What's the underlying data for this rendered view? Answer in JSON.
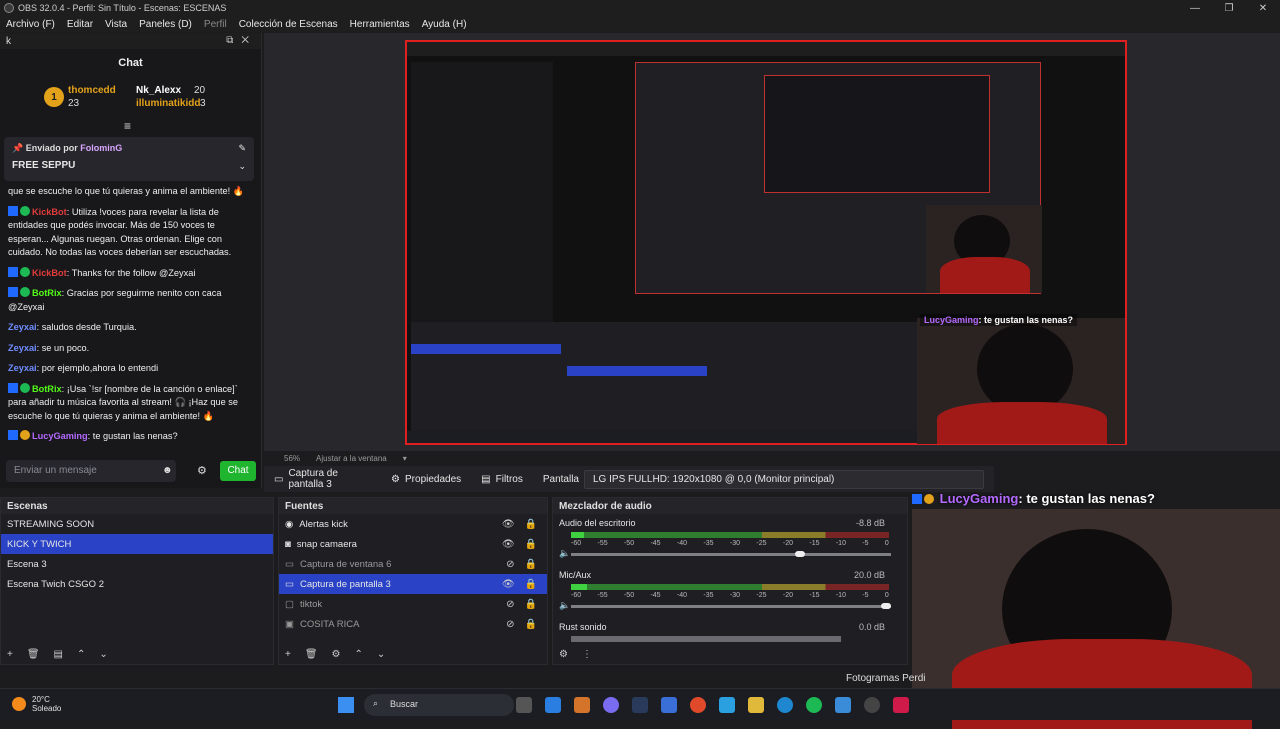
{
  "window": {
    "title": "OBS 32.0.4 - Perfil: Sin Título - Escenas: ESCENAS"
  },
  "menu": [
    {
      "label": "Archivo (F)"
    },
    {
      "label": "Editar"
    },
    {
      "label": "Vista"
    },
    {
      "label": "Paneles (D)"
    },
    {
      "label": "Perfil"
    },
    {
      "label": "Colección de Escenas"
    },
    {
      "label": "Herramientas"
    },
    {
      "label": "Ayuda (H)"
    }
  ],
  "chat": {
    "dock_title": "k",
    "title": "Chat",
    "leaderboard": {
      "rank": "1",
      "first": {
        "name": "thomcedd",
        "value": "23"
      },
      "second": {
        "name": "Nk_Alexx",
        "value": "20"
      },
      "third": {
        "name": "illuminatikidd",
        "value": "3"
      }
    },
    "pinned": {
      "prefix": "Enviado por",
      "user": "FolominG",
      "text": "FREE SEPPU"
    },
    "messages": [
      {
        "user": "",
        "text": "que se escuche lo que tú quieras y anima el ambiente! 🔥"
      },
      {
        "user": "KickBot",
        "text": ": Utiliza !voces para revelar la lista de entidades que podés invocar. Más de 150 voces te esperan... Algunas ruegan. Otras ordenan. Elige con cuidado. No todas las voces deberían ser escuchadas."
      },
      {
        "user": "KickBot",
        "text": ": Thanks for the follow @Zeyxai"
      },
      {
        "user": "BotRix",
        "text": ": Gracias por seguirme nenito con caca @Zeyxai"
      },
      {
        "user": "Zeyxai",
        "text": ": saludos desde Turquia."
      },
      {
        "user": "Zeyxai",
        "text": ": se un poco."
      },
      {
        "user": "Zeyxai",
        "text": ": por ejemplo,ahora lo entendi"
      },
      {
        "user": "BotRix",
        "text": ": ¡Usa `!sr [nombre de la canción o enlace]` para añadir tu música favorita al stream! 🎧 ¡Haz que se escuche lo que tú quieras y anima el ambiente! 🔥"
      },
      {
        "user": "LucyGaming",
        "text": ": te gustan las nenas?"
      }
    ],
    "input_placeholder": "Enviar un mensaje",
    "send_label": "Chat"
  },
  "overlay_text": {
    "user": "LucyGaming",
    "text": ": te gustan las nenas?"
  },
  "preview_status": {
    "zoom": "56%",
    "fit": "Ajustar a la ventana"
  },
  "toolbar": {
    "source_name": "Captura de pantalla 3",
    "properties": "Propiedades",
    "filters": "Filtros",
    "screen_label": "Pantalla",
    "screen_value": "LG IPS FULLHD: 1920x1080 @ 0,0 (Monitor principal)"
  },
  "scenes": {
    "title": "Escenas",
    "items": [
      {
        "label": "STREAMING SOON"
      },
      {
        "label": "KICK Y TWICH"
      },
      {
        "label": "Escena 3"
      },
      {
        "label": "Escena Twich CSGO 2"
      }
    ]
  },
  "sources": {
    "title": "Fuentes",
    "items": [
      {
        "label": "Alertas kick"
      },
      {
        "label": "snap camaera"
      },
      {
        "label": "Captura de ventana 6"
      },
      {
        "label": "Captura de pantalla 3"
      },
      {
        "label": "tiktok"
      },
      {
        "label": "COSITA RICA"
      }
    ]
  },
  "mixer": {
    "title": "Mezclador de audio",
    "ticks": [
      "-60",
      "-55",
      "-50",
      "-45",
      "-40",
      "-35",
      "-30",
      "-25",
      "-20",
      "-15",
      "-10",
      "-5",
      "0"
    ],
    "channels": [
      {
        "name": "Audio del escritorio",
        "db": "-8.8 dB",
        "level": 0.04,
        "volume": 0.73
      },
      {
        "name": "Mic/Aux",
        "db": "20.0 dB",
        "level": 0.05,
        "volume": 1.0
      },
      {
        "name": "Rust sonido",
        "db": "0.0 dB",
        "level": 0,
        "volume": 1.0
      }
    ]
  },
  "stats": {
    "frames_label": "Fotogramas Perdi"
  },
  "taskbar": {
    "temp": "20°C",
    "weather": "Soleado",
    "search": "Buscar"
  }
}
